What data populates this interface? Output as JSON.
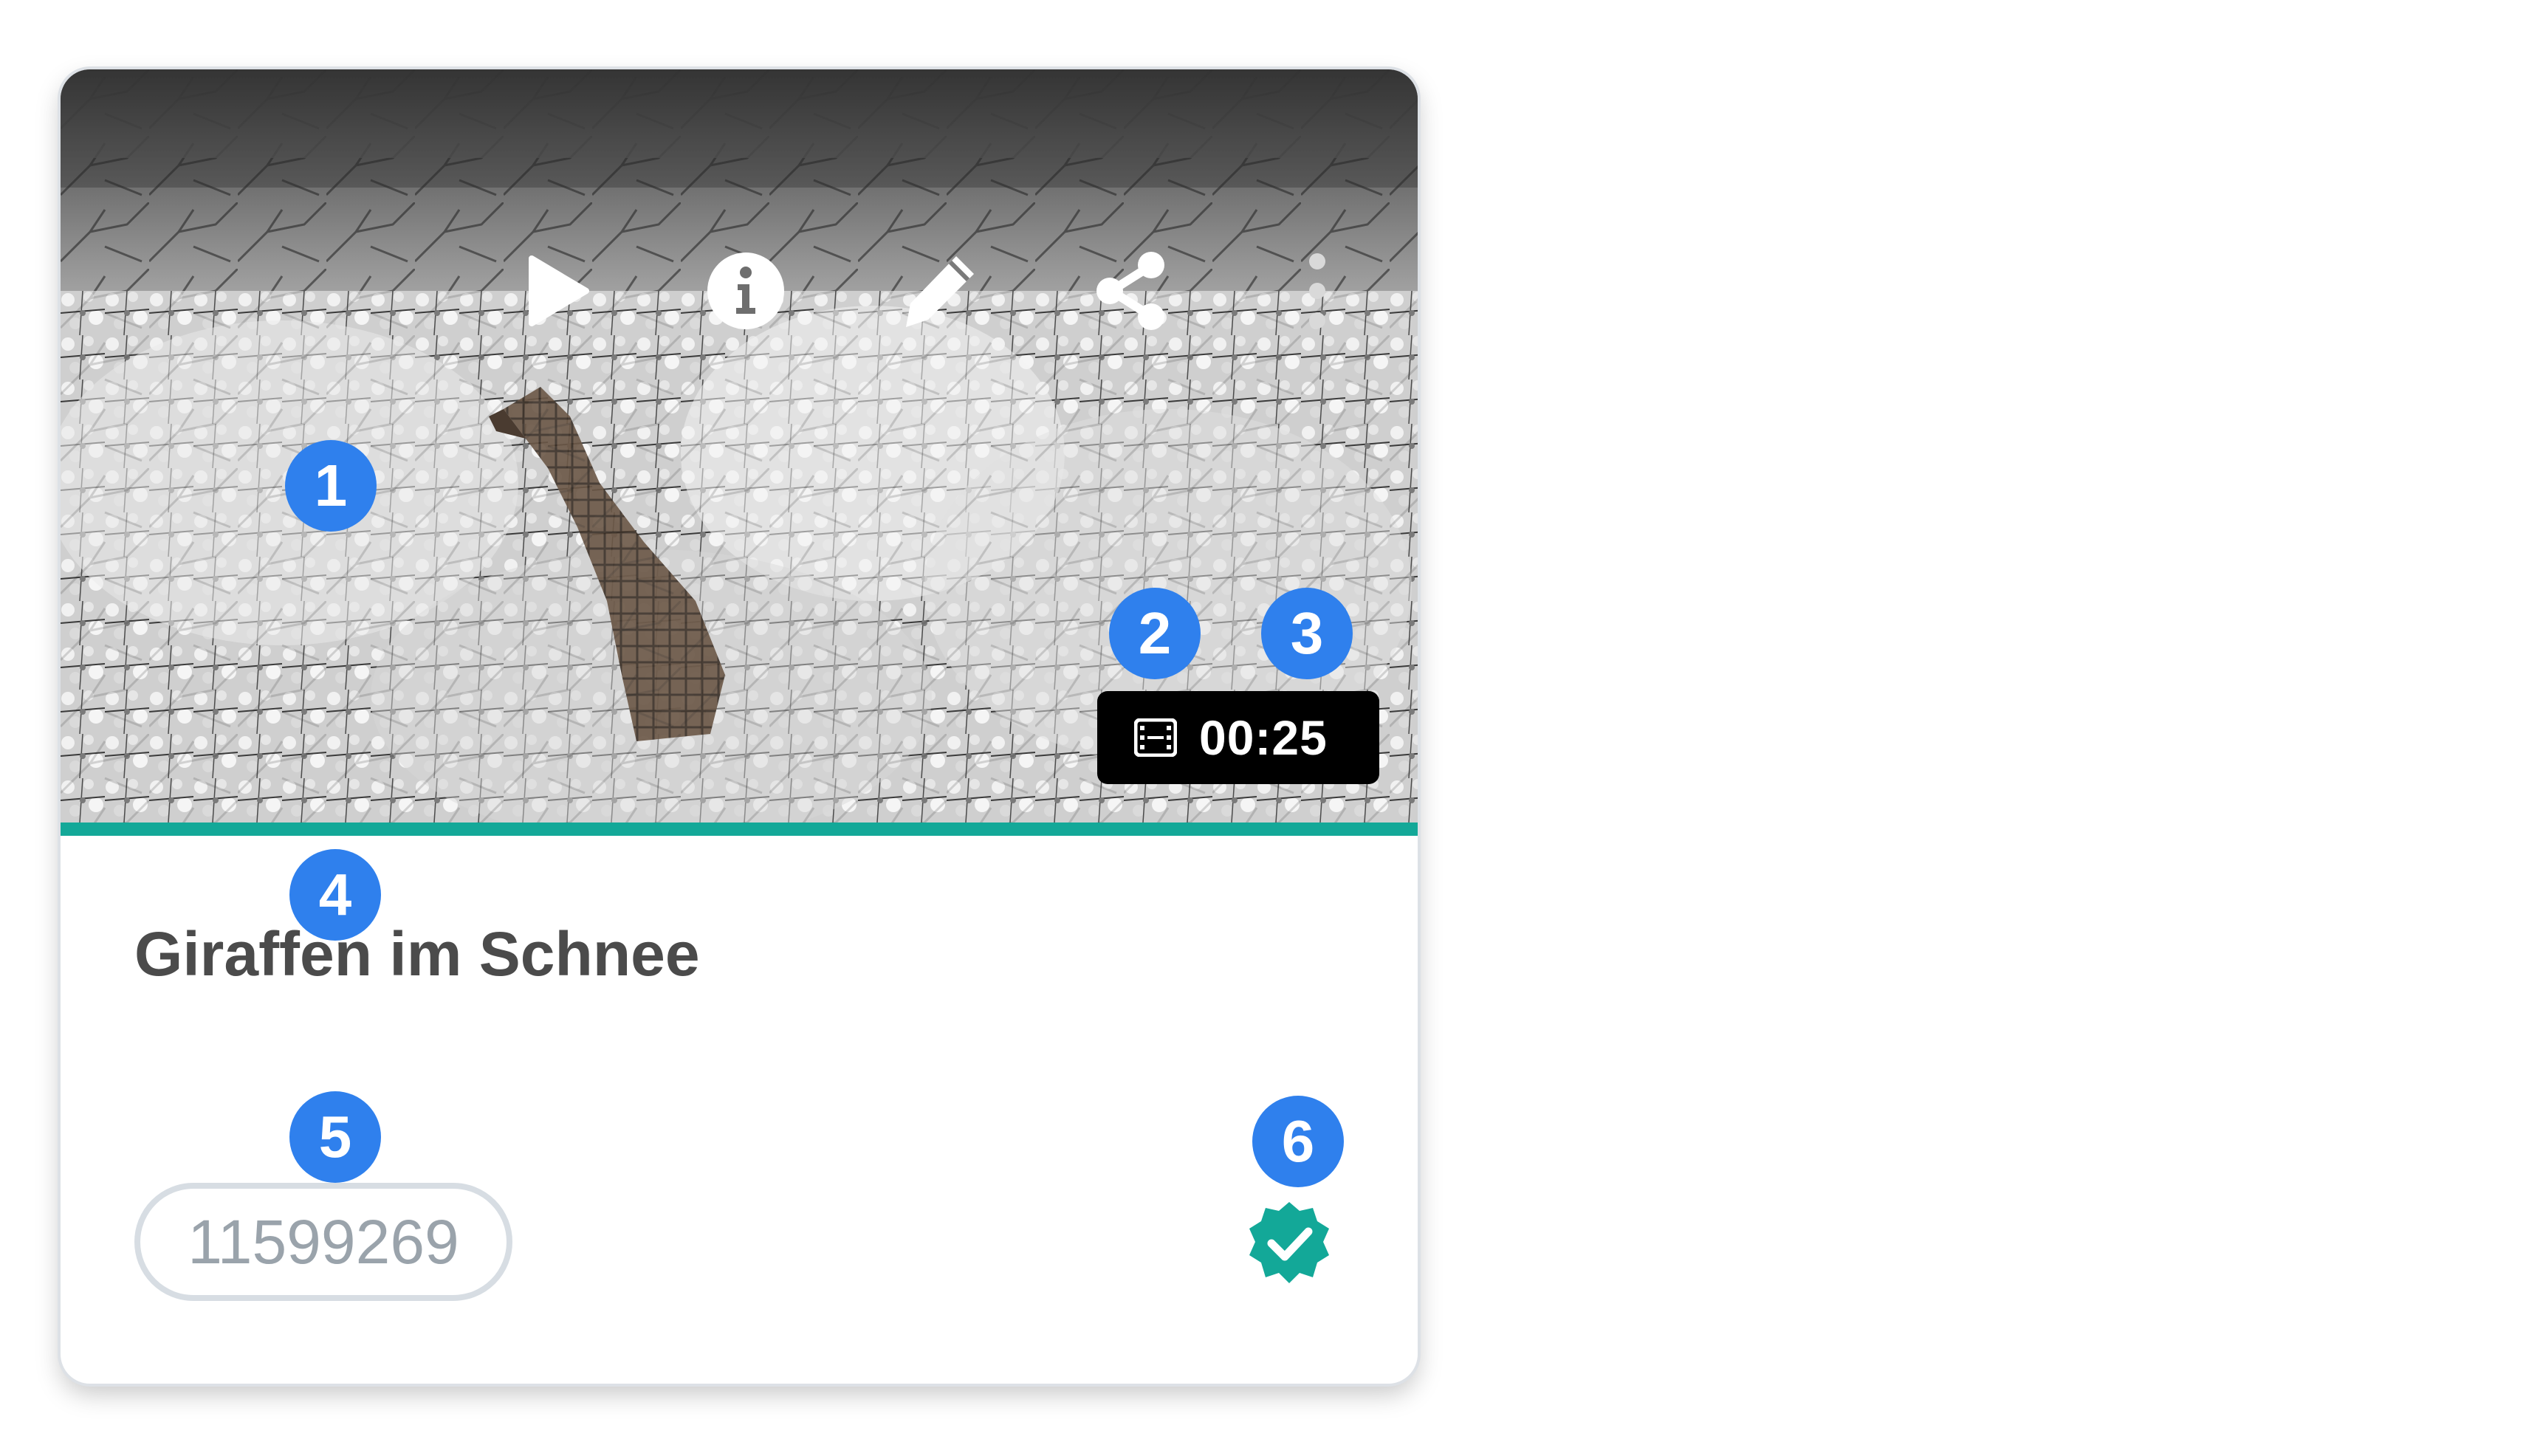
{
  "card": {
    "title": "Giraffen im Schnee",
    "duration": "00:25",
    "media_id": "11599269",
    "status": "verified",
    "progress_fraction": 1.0
  },
  "toolbar": {
    "icons": [
      "play-icon",
      "info-icon",
      "pencil-icon",
      "share-icon",
      "more-vertical-icon"
    ]
  },
  "duration_icon": "film-icon",
  "status_icon": "verified-badge-icon",
  "colors": {
    "accent": "#13a898",
    "marker": "#2f80ed",
    "title": "#4b4b4b",
    "id_text": "#9aa3ab",
    "duration_bg": "#000000"
  },
  "annotations": [
    "1",
    "2",
    "3",
    "4",
    "5",
    "6"
  ]
}
